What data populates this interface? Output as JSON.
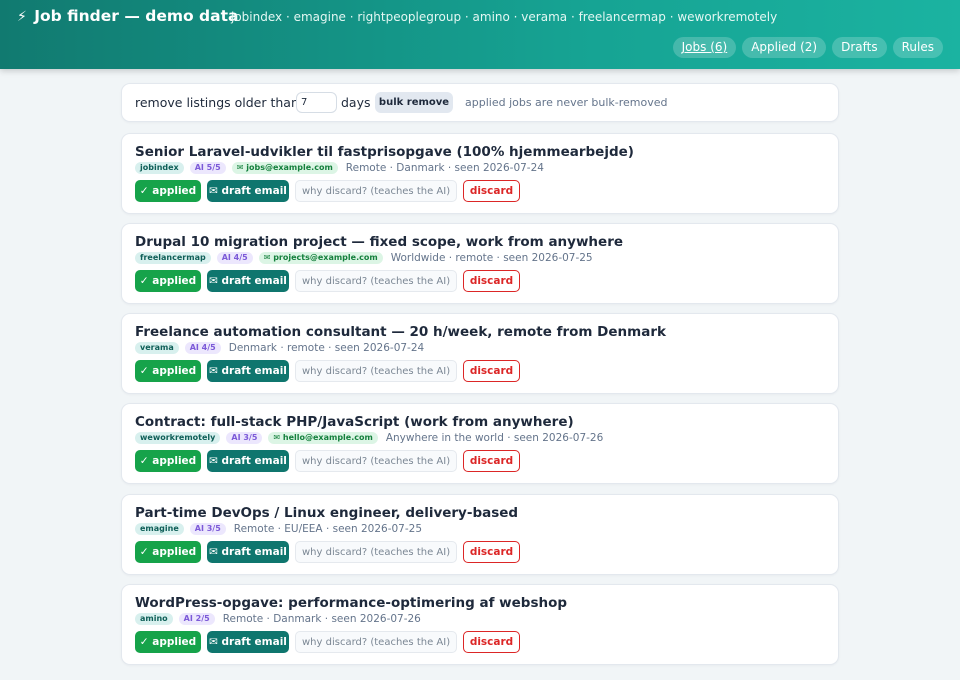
{
  "header": {
    "bolt_icon": "⚡",
    "title": "Job finder — demo data",
    "sources": "jobindex · emagine · rightpeoplegroup · amino · verama · freelancermap · weworkremotely",
    "tabs": [
      {
        "label": "Jobs (6)",
        "active": true
      },
      {
        "label": "Applied (2)",
        "active": false
      },
      {
        "label": "Drafts",
        "active": false
      },
      {
        "label": "Rules",
        "active": false
      }
    ]
  },
  "bulk": {
    "label": "remove listings older than",
    "days_value": "7",
    "days_label": "days",
    "button": "bulk remove",
    "note": "applied jobs are never bulk-removed"
  },
  "actions": {
    "applied": "✓ applied",
    "draft": "✉ draft email",
    "discard_placeholder": "why discard? (teaches the AI)",
    "discard": "discard"
  },
  "jobs": [
    {
      "title": "Senior Laravel-udvikler til fastprisopgave (100% hjemmearbejde)",
      "source": "jobindex",
      "ai": "AI 5/5",
      "email": "✉ jobs@example.com",
      "meta": "Remote · Danmark · seen 2026-07-24"
    },
    {
      "title": "Drupal 10 migration project — fixed scope, work from anywhere",
      "source": "freelancermap",
      "ai": "AI 4/5",
      "email": "✉ projects@example.com",
      "meta": "Worldwide · remote · seen 2026-07-25"
    },
    {
      "title": "Freelance automation consultant — 20 h/week, remote from Denmark",
      "source": "verama",
      "ai": "AI 4/5",
      "email": "",
      "meta": "Denmark · remote · seen 2026-07-24"
    },
    {
      "title": "Contract: full-stack PHP/JavaScript (work from anywhere)",
      "source": "weworkremotely",
      "ai": "AI 3/5",
      "email": "✉ hello@example.com",
      "meta": "Anywhere in the world · seen 2026-07-26"
    },
    {
      "title": "Part-time DevOps / Linux engineer, delivery-based",
      "source": "emagine",
      "ai": "AI 3/5",
      "email": "",
      "meta": "Remote · EU/EEA · seen 2026-07-25"
    },
    {
      "title": "WordPress-opgave: performance-optimering af webshop",
      "source": "amino",
      "ai": "AI 2/5",
      "email": "",
      "meta": "Remote · Danmark · seen 2026-07-26"
    }
  ]
}
